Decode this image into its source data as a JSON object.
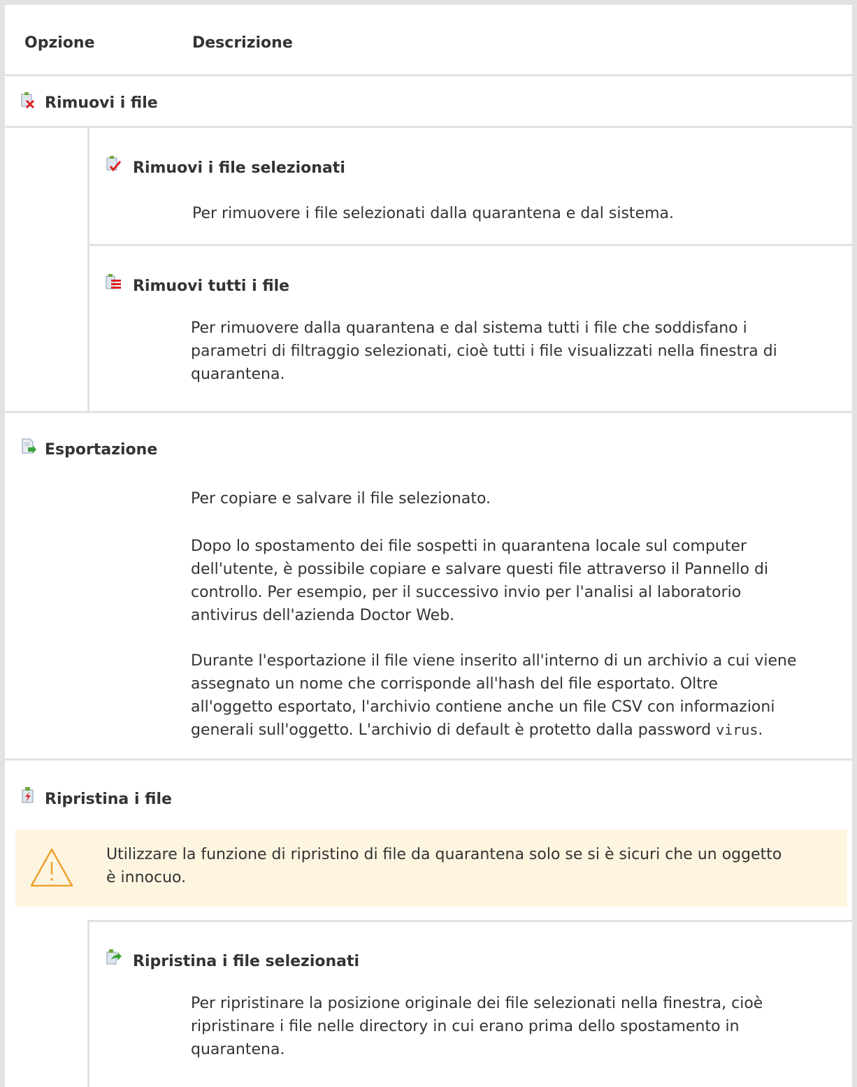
{
  "table": {
    "col_option": "Opzione",
    "col_description": "Descrizione"
  },
  "sections": {
    "remove": {
      "title": "Rimuovi i file",
      "icon": "remove-files-icon",
      "selected": {
        "title": "Rimuovi i file selezionati",
        "icon": "remove-selected-icon",
        "desc": "Per rimuovere i file selezionati dalla quarantena e dal sistema."
      },
      "all": {
        "title": "Rimuovi tutti i file",
        "icon": "remove-all-icon",
        "desc_lines": [
          "Per rimuovere dalla quarantena e dal sistema tutti i file che soddisfano i",
          "parametri di filtraggio selezionati, cioè tutti i file visualizzati nella finestra di",
          "quarantena."
        ]
      }
    },
    "export": {
      "title": "Esportazione",
      "icon": "export-icon",
      "p1": "Per copiare e salvare il file selezionato.",
      "p2_lines": [
        "Dopo lo spostamento dei file sospetti in quarantena locale sul computer",
        "dell'utente, è possibile copiare e salvare questi file attraverso il Pannello di",
        "controllo. Per esempio, per il successivo invio per l'analisi al laboratorio",
        "antivirus dell'azienda Doctor Web."
      ],
      "p3_lines": [
        "Durante l'esportazione il file viene inserito all'interno di un archivio a cui viene",
        "assegnato un nome che corrisponde all'hash del file esportato. Oltre",
        "all'oggetto esportato, l'archivio contiene anche un file CSV con informazioni"
      ],
      "p3_last_prefix": "generali sull'oggetto. L'archivio di default è protetto dalla password ",
      "p3_password": "virus",
      "p3_last_suffix": "."
    },
    "restore": {
      "title": "Ripristina i file",
      "icon": "restore-files-icon",
      "warning_lines": [
        "Utilizzare la funzione di ripristino di file da quarantena solo se si è sicuri che un oggetto",
        "è innocuo."
      ],
      "selected": {
        "title": "Ripristina i file selezionati",
        "icon": "restore-selected-icon",
        "desc_lines": [
          "Per ripristinare la posizione originale dei file selezionati nella finestra, cioè",
          "ripristinare i file nelle directory in cui erano prima dello spostamento in",
          "quarantena."
        ]
      }
    }
  },
  "colors": {
    "border": "#e2e2e2",
    "warning_bg": "#fdf5e0",
    "warning_icon": "#f0a030",
    "text": "#333333"
  }
}
